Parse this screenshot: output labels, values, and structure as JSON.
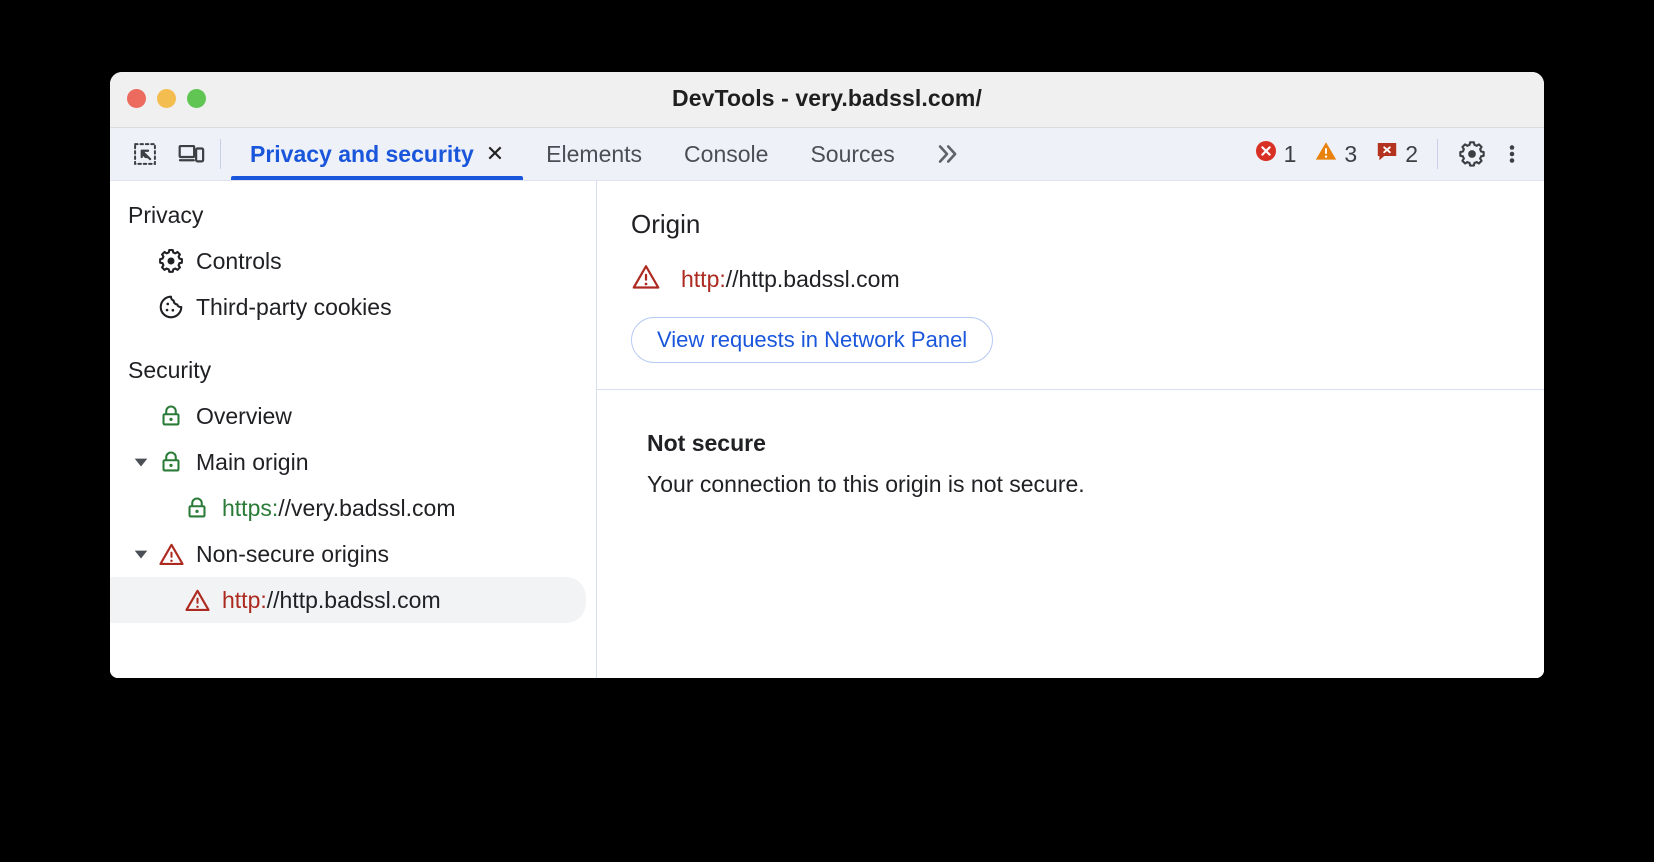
{
  "window": {
    "title": "DevTools - very.badssl.com/",
    "traffic_lights": [
      "close-button",
      "minimize-button",
      "maximize-button"
    ]
  },
  "toolbar": {
    "left_icons": [
      {
        "name": "inspect-element-icon",
        "label": "Inspect element"
      },
      {
        "name": "device-toolbar-icon",
        "label": "Toggle device toolbar"
      }
    ],
    "tabs": [
      {
        "label": "Privacy and security",
        "active": true,
        "closable": true,
        "close_label": "✕"
      },
      {
        "label": "Elements",
        "active": false,
        "closable": false
      },
      {
        "label": "Console",
        "active": false,
        "closable": false
      },
      {
        "label": "Sources",
        "active": false,
        "closable": false
      }
    ],
    "overflow_label": "»",
    "counters": [
      {
        "name": "error-count",
        "icon": "error-circle-icon",
        "value": "1",
        "color": "#d93025"
      },
      {
        "name": "warning-count",
        "icon": "warning-triangle-icon",
        "value": "3",
        "color": "#e8820c"
      },
      {
        "name": "issue-count",
        "icon": "issue-message-icon",
        "value": "2",
        "color": "#b4331f"
      }
    ],
    "settings_label": "Settings",
    "more_label": "Customize and control DevTools"
  },
  "sidebar": {
    "groups": [
      {
        "title": "Privacy",
        "items": [
          {
            "label": "Controls",
            "icon": "gear-icon",
            "indent": 1,
            "twisty": "none",
            "selected": false
          },
          {
            "label": "Third-party cookies",
            "icon": "cookie-icon",
            "indent": 1,
            "twisty": "none",
            "selected": false
          }
        ]
      },
      {
        "title": "Security",
        "items": [
          {
            "label": "Overview",
            "icon": "lock-green-icon",
            "indent": 1,
            "twisty": "none",
            "selected": false
          },
          {
            "label": "Main origin",
            "icon": "lock-green-icon",
            "indent": 0,
            "twisty": "expanded",
            "selected": false
          },
          {
            "scheme": "https:",
            "host": "//very.badssl.com",
            "icon": "lock-green-icon",
            "indent": 2,
            "twisty": "none",
            "selected": false,
            "secure": true
          },
          {
            "label": "Non-secure origins",
            "icon": "warning-triangle-red-icon",
            "indent": 0,
            "twisty": "expanded",
            "selected": false
          },
          {
            "scheme": "http:",
            "host": "//http.badssl.com",
            "icon": "warning-triangle-red-icon",
            "indent": 2,
            "twisty": "none",
            "selected": true,
            "secure": false
          }
        ]
      }
    ]
  },
  "main": {
    "origin_section": {
      "title": "Origin",
      "origin_icon": "warning-triangle-red-icon",
      "origin_scheme": "http:",
      "origin_host": "//http.badssl.com",
      "button_label": "View requests in Network Panel"
    },
    "connection_section": {
      "heading": "Not secure",
      "description": "Your connection to this origin is not secure."
    }
  },
  "colors": {
    "accent_blue": "#1a56db",
    "secure_green": "#2a7b38",
    "insecure_red": "#ad2a20",
    "error_red": "#d93025",
    "warning_orange": "#e8820c",
    "issue_red": "#b4331f",
    "tabbar_bg": "#eef1f8",
    "titlebar_bg": "#f0f0f0"
  }
}
